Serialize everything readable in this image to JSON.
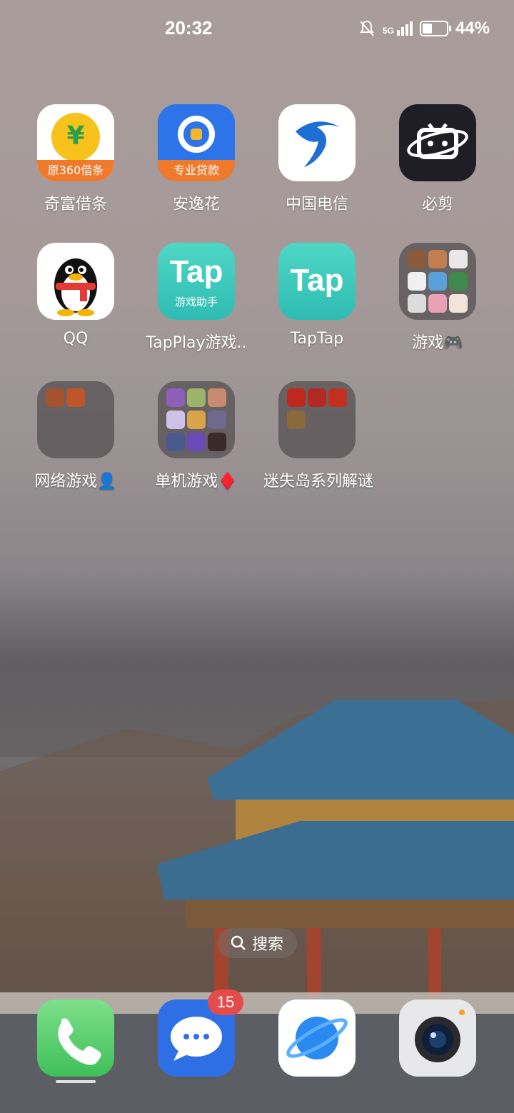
{
  "status_bar": {
    "time": "20:32",
    "network": "5G",
    "battery_percent": "44%",
    "battery_level": 0.44
  },
  "apps_row1": [
    {
      "label": "奇富借条",
      "icon_text": "原360借条",
      "icon": "yuan-coin-icon"
    },
    {
      "label": "安逸花",
      "icon_text": "专业贷款",
      "icon": "anyihua-logo-icon"
    },
    {
      "label": "中国电信",
      "icon": "china-telecom-logo-icon"
    },
    {
      "label": "必剪",
      "icon": "bijian-tv-logo-icon"
    }
  ],
  "apps_row2": [
    {
      "label": "QQ",
      "icon": "penguin-icon"
    },
    {
      "label": "TapPlay游戏..",
      "icon_text": "Tap",
      "icon_subtext": "游戏助手",
      "icon": "tapplay-logo-icon"
    },
    {
      "label": "TapTap",
      "icon_text": "Tap",
      "icon": "taptap-logo-icon"
    },
    {
      "label": "游戏🎮",
      "icon": "folder-icon"
    }
  ],
  "folders_row3": [
    {
      "label": "网络游戏👤",
      "icon": "folder-icon"
    },
    {
      "label": "单机游戏♦️",
      "icon": "folder-icon"
    },
    {
      "label": "迷失岛系列解谜",
      "icon": "folder-icon"
    }
  ],
  "search": {
    "label": "搜索"
  },
  "dock": [
    {
      "name": "phone",
      "icon": "phone-icon"
    },
    {
      "name": "messages",
      "icon": "chat-bubble-icon",
      "badge": "15"
    },
    {
      "name": "browser",
      "icon": "planet-icon"
    },
    {
      "name": "camera",
      "icon": "camera-icon"
    }
  ]
}
